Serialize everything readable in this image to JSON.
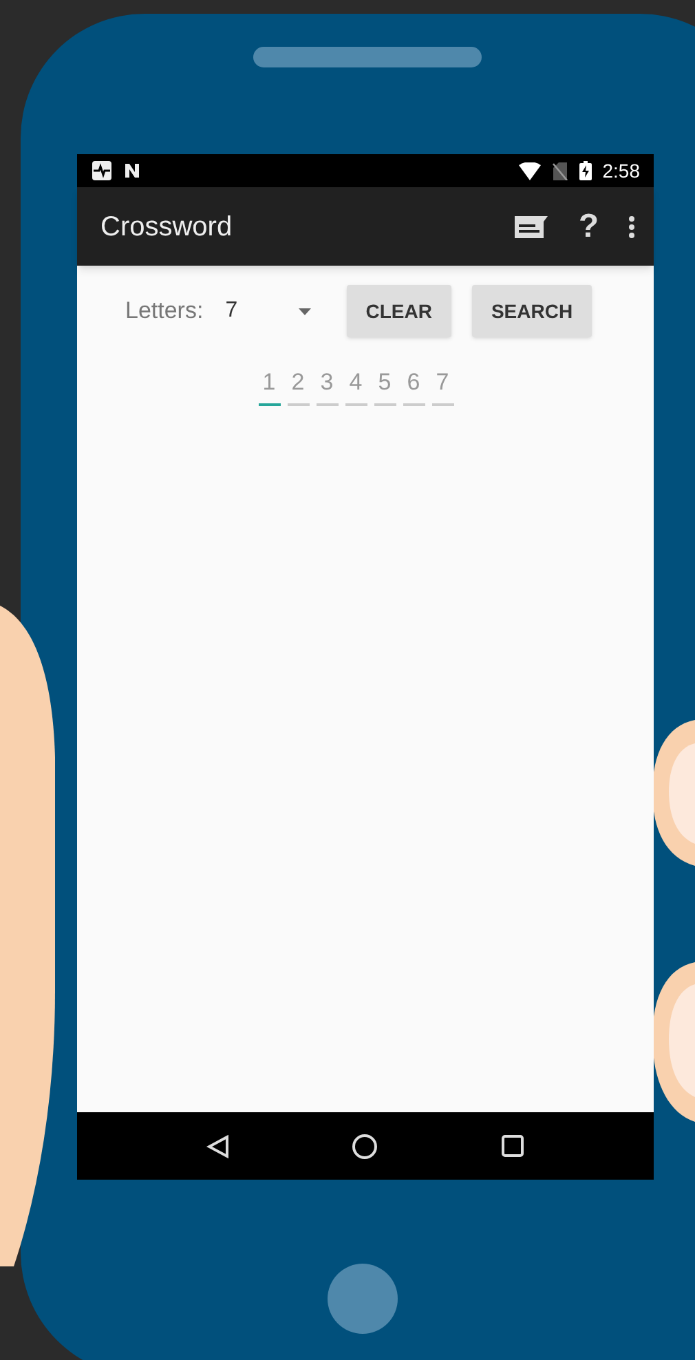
{
  "status_bar": {
    "time": "2:58"
  },
  "toolbar": {
    "title": "Crossword",
    "actions": [
      {
        "kind": "message"
      },
      {
        "kind": "help",
        "glyph": "?"
      },
      {
        "kind": "overflow"
      }
    ]
  },
  "controls": {
    "letters_label": "Letters:",
    "letters_value": "7",
    "buttons": [
      "CLEAR",
      "SEARCH"
    ]
  },
  "letter_fields": [
    {
      "placeholder": "1",
      "selected": true
    },
    {
      "placeholder": "2",
      "selected": false
    },
    {
      "placeholder": "3",
      "selected": false
    },
    {
      "placeholder": "4",
      "selected": false
    },
    {
      "placeholder": "5",
      "selected": false
    },
    {
      "placeholder": "6",
      "selected": false
    },
    {
      "placeholder": "7",
      "selected": false
    }
  ]
}
